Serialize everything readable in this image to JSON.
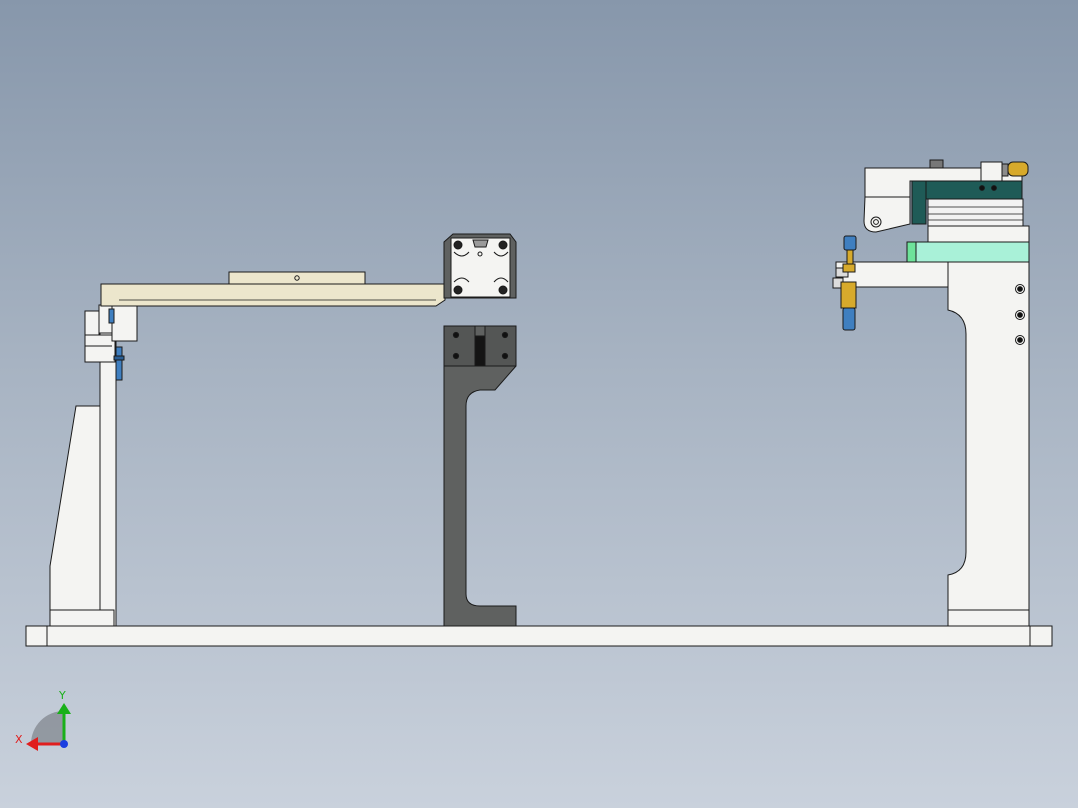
{
  "viewport": {
    "colors": {
      "background_top": "#8797ab",
      "background_bottom": "#c9d1dc",
      "part_white": "#f4f4f2",
      "part_edge": "#1a1a1a",
      "arm_beige": "#ece6cc",
      "column_gray": "#5f6160",
      "clamp_teal": "#1f5b57",
      "block_mint": "#a9f1d8",
      "block_green": "#6ee39a",
      "pin_blue": "#3f7fc0",
      "pin_gold": "#d7aa2c"
    }
  },
  "triad": {
    "x_label": "X",
    "y_label": "Y",
    "x_color": "#e01e1e",
    "y_color": "#19b019",
    "z_color": "#1b3ee0"
  }
}
